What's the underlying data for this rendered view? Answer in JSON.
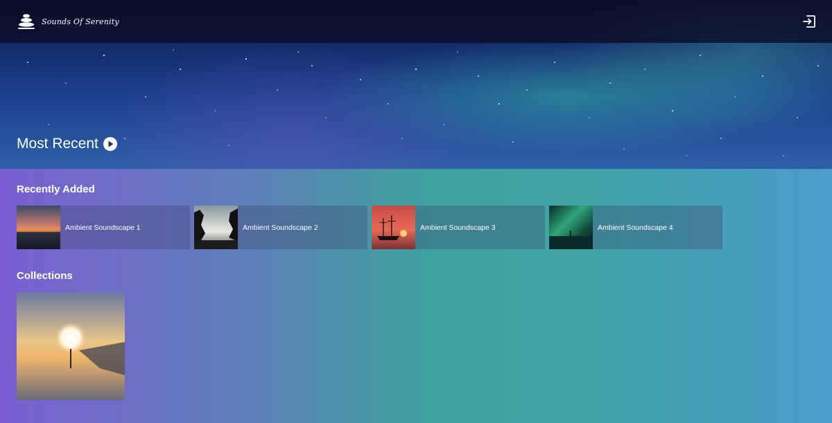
{
  "app": {
    "brand_name": "Sounds Of Serenity"
  },
  "icons": {
    "logo": "stacked-stones-icon",
    "logout": "logout-icon",
    "play": "play-circle-icon"
  },
  "hero": {
    "title": "Most Recent"
  },
  "recently_added": {
    "title": "Recently Added",
    "items": [
      {
        "label": "Ambient Soundscape 1",
        "image": "sunset-over-water"
      },
      {
        "label": "Ambient Soundscape 2",
        "image": "tree-silhouettes"
      },
      {
        "label": "Ambient Soundscape 3",
        "image": "tall-ship-at-sunset"
      },
      {
        "label": "Ambient Soundscape 4",
        "image": "aurora-over-water"
      }
    ]
  },
  "collections": {
    "title": "Collections",
    "items": [
      {
        "image": "light-orb-on-beach"
      }
    ]
  },
  "colors": {
    "topbar": "#0a0c23",
    "gradient_left": "#7b5fd2",
    "gradient_mid": "#3ea39e",
    "gradient_right": "#4a9ccb"
  }
}
